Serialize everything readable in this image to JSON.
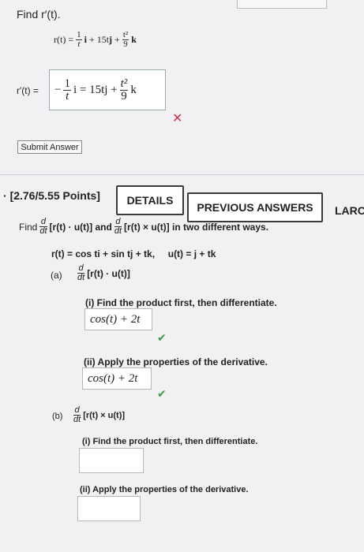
{
  "problem1": {
    "prompt": "Find r′(t).",
    "given": {
      "lhs": "r(t) =",
      "frac1_num": "1",
      "frac1_den": "t",
      "i": "i",
      "plus1": " + 15t",
      "j": "j",
      "plus2": " + ",
      "frac2_num": "t²",
      "frac2_den": "9",
      "k": "k"
    },
    "answer_label": "r′(t) =",
    "answer": {
      "minus": "−",
      "frac1_num": "1",
      "frac1_den": "t",
      "middle": "i = 15tj + ",
      "frac2_num": "t²",
      "frac2_den": "9",
      "k": "k"
    },
    "status": "✕",
    "submit_label": "Submit Answer"
  },
  "problem2": {
    "points": "[2.76/5.55 Points]",
    "details_label": "DETAILS",
    "previous_label": "PREVIOUS ANSWERS",
    "larc_label": "LARC",
    "intro_find": "Find",
    "d": "d",
    "dt": "dt",
    "dot_expr": "[r(t) · u(t)] and",
    "cross_expr": "[r(t) × u(t)] in two different ways.",
    "r_def": "r(t) = cos ti + sin tj + tk,",
    "u_def": "u(t) = j + tk",
    "part_a": {
      "label": "(a)",
      "expr": "[r(t) · u(t)]",
      "i_text": "(i) Find the product first, then differentiate.",
      "i_answer": "cos(t) + 2t",
      "ii_text": "(ii) Apply the properties of the derivative.",
      "ii_answer": "cos(t) + 2t",
      "check": "✔"
    },
    "part_b": {
      "label": "(b)",
      "expr": "[r(t) × u(t)]",
      "i_text": "(i) Find the product first, then differentiate.",
      "i_answer": "",
      "ii_text": "(ii) Apply the properties of the derivative.",
      "ii_answer": ""
    }
  }
}
